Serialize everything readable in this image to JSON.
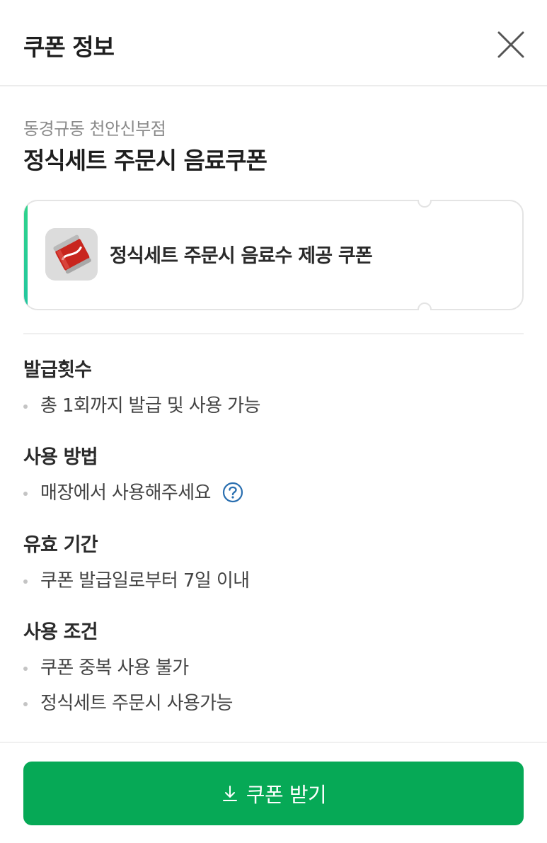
{
  "header": {
    "title": "쿠폰 정보"
  },
  "coupon": {
    "store_name": "동경규동 천안신부점",
    "title": "정식세트 주문시 음료쿠폰",
    "ticket_description": "정식세트 주문시 음료수 제공 쿠폰",
    "accent_color": "#2fd38a"
  },
  "sections": [
    {
      "title": "발급횟수",
      "items": [
        "총 1회까지 발급 및 사용 가능"
      ]
    },
    {
      "title": "사용 방법",
      "items": [
        "매장에서 사용해주세요"
      ]
    },
    {
      "title": "유효 기간",
      "items": [
        "쿠폰 발급일로부터 7일 이내"
      ]
    },
    {
      "title": "사용 조건",
      "items": [
        "쿠폰 중복 사용 불가",
        "정식세트 주문시 사용가능"
      ]
    }
  ],
  "cta": {
    "label": "쿠폰 받기",
    "icon": "download-icon",
    "color": "#06a956"
  }
}
